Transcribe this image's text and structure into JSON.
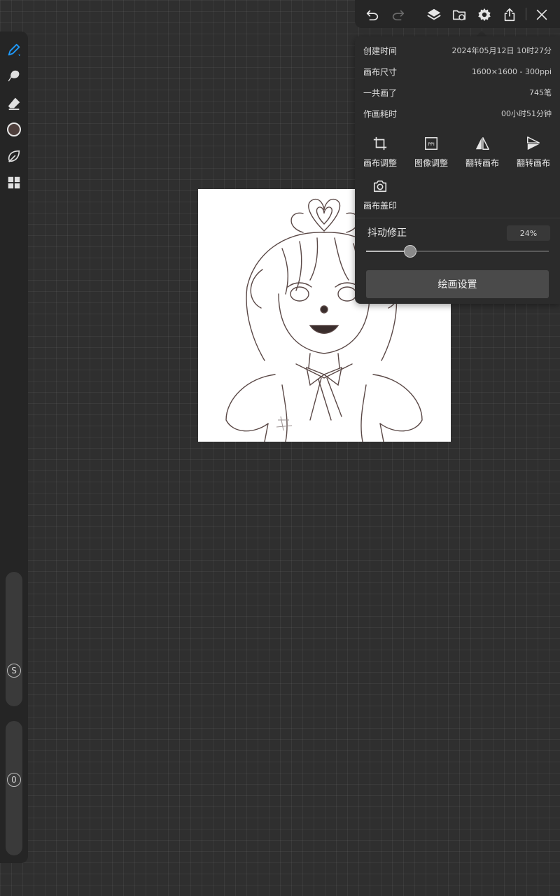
{
  "toolbar": {
    "undo": "undo-icon",
    "redo": "redo-icon",
    "layers": "layers-icon",
    "import": "folder-icon",
    "settings": "gear-icon",
    "share": "share-icon",
    "close": "close-icon"
  },
  "left_tools": {
    "brush": "brush-icon",
    "smudge": "smudge-icon",
    "eraser": "eraser-icon",
    "color_hex": "#4e3f3c",
    "liquify": "leaf-icon",
    "gallery": "grid-icon",
    "size_label": "S",
    "opacity_label": "0"
  },
  "info": {
    "created_label": "创建时间",
    "created_value": "2024年05月12日 10时27分",
    "size_label": "画布尺寸",
    "size_value": "1600×1600 - 300ppi",
    "strokes_label": "一共画了",
    "strokes_value": "745笔",
    "time_label": "作画耗时",
    "time_value": "00小时51分钟"
  },
  "actions": [
    {
      "label": "画布调整",
      "icon": "crop-icon"
    },
    {
      "label": "图像调整",
      "icon": "ppi-icon"
    },
    {
      "label": "翻转画布",
      "icon": "flip-horizontal-icon"
    },
    {
      "label": "翻转画布",
      "icon": "flip-vertical-icon"
    },
    {
      "label": "画布盖印",
      "icon": "camera-icon"
    }
  ],
  "ppi_text": "PPI",
  "stabilizer": {
    "label": "抖动修正",
    "value_text": "24%",
    "value": 0.24
  },
  "settings_button": "绘画设置",
  "colors": {
    "accent": "#1e9bff"
  }
}
